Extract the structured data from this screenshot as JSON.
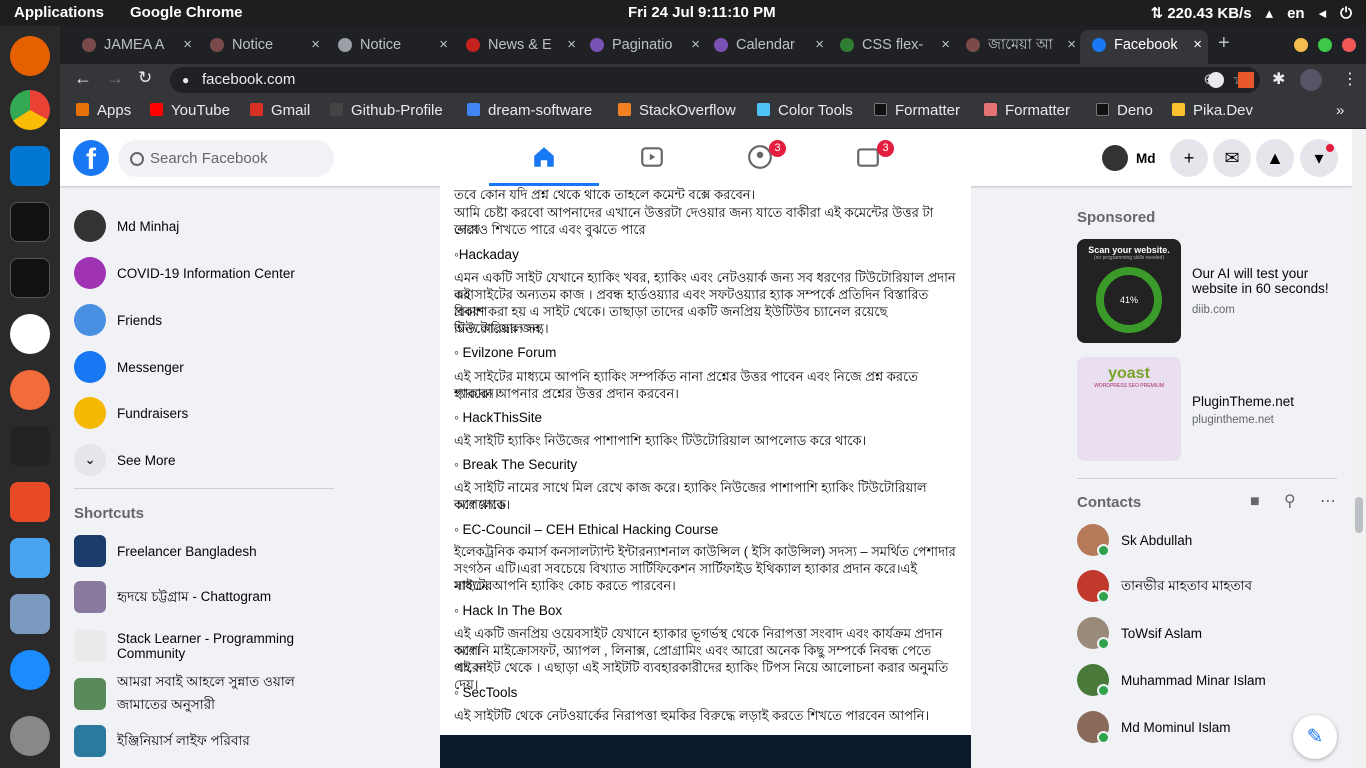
{
  "system": {
    "apps": "Applications",
    "active_app": "Google Chrome",
    "clock": "Fri 24 Jul   9:11:10 PM",
    "network": "⇅ 220.43 KB/s",
    "lang": "en"
  },
  "tabs": [
    {
      "label": "JAMEA A",
      "color": "#7a4a4a"
    },
    {
      "label": "Notice",
      "color": "#7a4a4a"
    },
    {
      "label": "Notice",
      "color": "#9aa0a6"
    },
    {
      "label": "News & E",
      "color": "#c5221f"
    },
    {
      "label": "Paginatio",
      "color": "#7952b3"
    },
    {
      "label": "Calendar",
      "color": "#7952b3"
    },
    {
      "label": "CSS flex-",
      "color": "#2e7d32"
    },
    {
      "label": "জামেয়া আ",
      "color": "#7a4a4a"
    },
    {
      "label": "Facebook",
      "color": "#1877f2"
    }
  ],
  "address": {
    "url": "facebook.com"
  },
  "bookmarks": [
    {
      "label": "Apps",
      "color": "#e8710a"
    },
    {
      "label": "YouTube",
      "color": "#ff0000"
    },
    {
      "label": "Gmail",
      "color": "#d93025"
    },
    {
      "label": "Github-Profile",
      "color": "#444"
    },
    {
      "label": "dream-software",
      "color": "#4285f4"
    },
    {
      "label": "StackOverflow",
      "color": "#f48024"
    },
    {
      "label": "Color Tools",
      "color": "#4fc3f7"
    },
    {
      "label": "Formatter",
      "color": "#111"
    },
    {
      "label": "Formatter",
      "color": "#e57373"
    },
    {
      "label": "Deno",
      "color": "#111"
    },
    {
      "label": "Pika.Dev",
      "color": "#fbc02d"
    }
  ],
  "fb": {
    "logo": "f",
    "search_placeholder": "Search Facebook",
    "groups_badge": "3",
    "gaming_badge": "3",
    "user_short": "Md"
  },
  "left_nav": [
    {
      "label": "Md Minhaj",
      "color": "#333"
    },
    {
      "label": "COVID-19 Information Center",
      "color": "#a033b4"
    },
    {
      "label": "Friends",
      "color": "#4a90e2"
    },
    {
      "label": "Messenger",
      "color": "#1877f2"
    },
    {
      "label": "Fundraisers",
      "color": "#f5b800"
    },
    {
      "label": "See More",
      "color": "#e4e6eb"
    }
  ],
  "shortcuts_title": "Shortcuts",
  "shortcuts": [
    {
      "label": "Freelancer Bangladesh",
      "color": "#1a3d6d"
    },
    {
      "label": "হৃদয়ে চট্টগ্রাম - Chattogram",
      "color": "#8a7aa0"
    },
    {
      "label": "Stack Learner - Programming Community",
      "color": "#eaeaea"
    },
    {
      "label": "আমরা সবাই আহলে সুন্নাত ওয়াল জামাতের অনুসারী",
      "color": "#5a8a5a"
    },
    {
      "label": "ইঞ্জিনিয়ার্স লাইফ পরিবার",
      "color": "#2a7aa0"
    }
  ],
  "post": {
    "lines": [
      {
        "t": "তবে কোন যদি প্রশ্ন থেকে থাকে তাহলে  কমেন্ট বক্সে করবেন।",
        "h": false
      },
      {
        "t": " আমি চেষ্টা করবো আপনাদের এখানে উত্তরটা দেওয়ার জন্য যাতে বাকীরা এই কমেন্টের উত্তর টা দেখে",
        "h": false
      },
      {
        "t": "তারাও শিখতে পারে এবং বুঝতে পারে",
        "h": false
      },
      {
        "t": "◦Hackaday",
        "h": true
      },
      {
        "t": "এমন একটি সাইট যেখানে হ্যাকিং খবর, হ্যাকিং এবং নেটওয়ার্ক জন্য সব ধরণের টিউটোরিয়াল প্রদান করা",
        "h": false
      },
      {
        "t": "এই সাইটের অন্যতম কাজ । প্রবন্ধ হার্ডওয়্যার এবং সফটওয়্যার হ্যাক সম্পর্কে প্রতিদিন বিস্তারিত বিবরণ",
        "h": false
      },
      {
        "t": "প্রকাশ করা হয় এ সাইট থেকে। তাছাড়া তাদের একটি জনপ্রিয় ইউটিউব চ্যানেল রয়েছে টিউটোরিয়াল সহ",
        "h": false
      },
      {
        "t": "অন্য কাজের জন্য।",
        "h": false
      },
      {
        "t": "◦ Evilzone Forum",
        "h": true
      },
      {
        "t": "এই সাইটের মাধ্যমে আপনি হ্যাকিং সম্পর্কিত নানা প্রশ্নের উত্তর পাবেন এবং নিজে প্রশ্ন করতে পারবেন।",
        "h": false
      },
      {
        "t": "হ্যাকারা আপনার প্রশ্নের উত্তর প্রদান করবেন।",
        "h": false
      },
      {
        "t": "◦ HackThisSite",
        "h": true
      },
      {
        "t": "এই সাইটি হ্যাকিং নিউজের পাশাপাশি হ্যাকিং টিউটোরিয়াল আপলোড করে থাকে।",
        "h": false
      },
      {
        "t": "◦ Break The Security",
        "h": true
      },
      {
        "t": "এই সাইটি নামের সাথে মিল রেখে কাজ করে। হ্যাকিং নিউজের পাশাপাশি হ্যাকিং টিউটোরিয়াল আপলোড",
        "h": false
      },
      {
        "t": "করে থাকে।",
        "h": false
      },
      {
        "t": "◦ EC-Council – CEH Ethical Hacking Course",
        "h": true
      },
      {
        "t": "ইলেকট্রনিক কমার্স কনসালট্যান্ট ইন্টারন্যাশনাল কাউন্সিল ( ইসি কাউন্সিল) সদস্য – সমর্থিত পেশাদার",
        "h": false
      },
      {
        "t": "সংগঠন এটি।এরা সবচেয়ে বিখ্যাত সার্টিফিকেশন সার্টিফাইড ইথিক্যাল হ্যাকার প্রদান করে।এই সাইটের",
        "h": false
      },
      {
        "t": "মাধ্যমে আপনি হ্যাকিং কোচ করতে পারবেন।",
        "h": false
      },
      {
        "t": "◦ Hack In The Box",
        "h": true
      },
      {
        "t": "এই একটি জনপ্রিয় ওয়েবসাইট যেখানে হ্যাকার ভূগর্ভস্থ থেকে নিরাপত্তা সংবাদ এবং কার্যক্রম প্রদান করে।",
        "h": false
      },
      {
        "t": "আপনি মাইক্রোসফট, অ্যাপল , লিনাক্স, প্রোগ্রামিং এবং আরো অনেক কিছু সম্পর্কে নিবন্ধ পেতে পারেন",
        "h": false
      },
      {
        "t": "এই সাইট থেকে । এছাড়া এই সাইটটি ব্যবহারকারীদের হ্যাকিং টিপস নিয়ে আলোচনা করার অনুমতি দেয়।",
        "h": false
      },
      {
        "t": "◦ SecTools",
        "h": true
      },
      {
        "t": "এই সাইটটি থেকে নেটওয়ার্কের নিরাপত্তা হুমকির বিরুদ্ধে লড়াই করতে শিখতে পারবেন আপনি।",
        "h": false
      }
    ]
  },
  "sponsored": {
    "title": "Sponsored",
    "ads": [
      {
        "title": "Our AI will test your website in 60 seconds!",
        "site": "diib.com",
        "img_top": "Scan your website.",
        "img_sub": "(no programming skills needed)",
        "img_pct": "41%",
        "color": "#222"
      },
      {
        "title": "PluginTheme.net",
        "site": "plugintheme.net",
        "img_top": "yoast",
        "img_sub": "WORDPRESS SEO PREMIUM",
        "color": "#e9dff0"
      }
    ]
  },
  "contacts": {
    "title": "Contacts",
    "items": [
      {
        "label": "Sk Abdullah",
        "color": "#b57a5a"
      },
      {
        "label": "তানভীর মাহতাব মাহতাব",
        "color": "#c0392b"
      },
      {
        "label": "ToWsif Aslam",
        "color": "#9a8a7a"
      },
      {
        "label": "Muhammad Minar Islam",
        "color": "#4a7a3a"
      },
      {
        "label": "Md Mominul Islam",
        "color": "#8a6a5a"
      }
    ]
  }
}
